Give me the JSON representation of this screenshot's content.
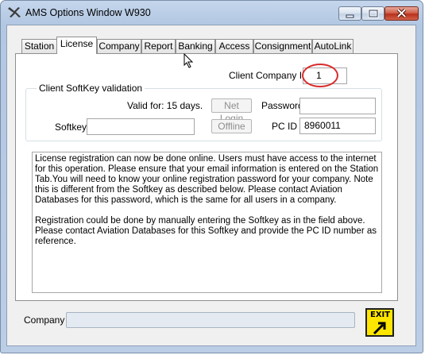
{
  "window": {
    "title": "AMS Options Window W930"
  },
  "tabs": [
    {
      "label": "Station"
    },
    {
      "label": "License",
      "active": true
    },
    {
      "label": "Company"
    },
    {
      "label": "Report"
    },
    {
      "label": "Banking"
    },
    {
      "label": "Access"
    },
    {
      "label": "Consignment"
    },
    {
      "label": "AutoLink"
    }
  ],
  "license": {
    "client_company_id_label": "Client Company ID",
    "client_company_id_value": "1",
    "group_title": "Client SoftKey validation",
    "valid_for_text": "Valid for: 15 days.",
    "net_login_label": "Net Login",
    "password_label": "Password",
    "password_value": "",
    "softkey_label": "Softkey",
    "softkey_value": "",
    "offline_label": "Offline",
    "pc_id_label": "PC ID",
    "pc_id_value": "8960011",
    "info_paragraph_1": "License registration can now be done online.  Users must have access to the internet for this operation.  Please ensure that your email information is entered on the Station Tab.You will need to know your online registration password for your company.  Note this is different from the Softkey as described below. Please contact Aviation Databases for this password, which is the same for all users in a company.",
    "info_paragraph_2": "Registration could be done by manually entering the Softkey as in the field above.  Please contact Aviation Databases for this Softkey and provide the PC ID number as reference."
  },
  "footer": {
    "company_label": "Company",
    "company_value": "",
    "exit_label": "EXIT"
  },
  "colors": {
    "highlight": "#d92b2b",
    "exit_button": "#ffe600"
  }
}
